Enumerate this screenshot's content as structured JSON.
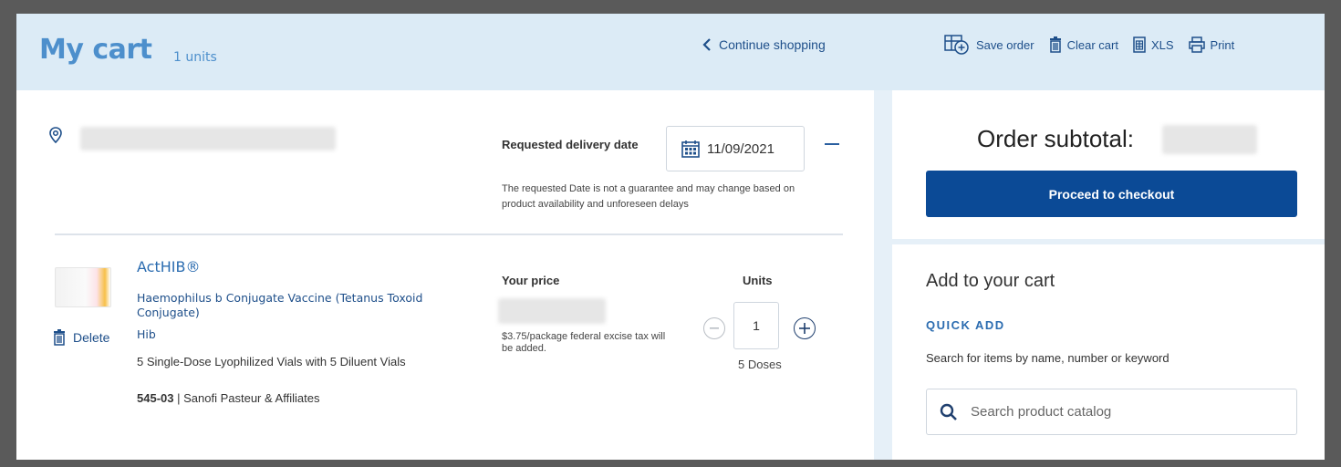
{
  "header": {
    "title": "My cart",
    "units_count": "1 units",
    "continue_label": "Continue shopping",
    "toolbar": {
      "save_order": "Save order",
      "clear_cart": "Clear cart",
      "xls": "XLS",
      "print": "Print"
    }
  },
  "delivery": {
    "requested_label": "Requested delivery date",
    "date": "11/09/2021",
    "note": "The requested Date is not a guarantee and may change based on product availability and unforeseen delays"
  },
  "item": {
    "name": "ActHIB®",
    "description": "Haemophilus b Conjugate Vaccine (Tetanus Toxoid Conjugate)",
    "abbreviation": "Hib",
    "packaging": "5 Single-Dose Lyophilized Vials with 5 Diluent Vials",
    "code": "545-03",
    "manufacturer": "| Sanofi Pasteur & Affiliates",
    "delete_label": "Delete",
    "price_label": "Your price",
    "price_note": "$3.75/package federal excise tax will be added.",
    "units_label": "Units",
    "quantity": "1",
    "doses": "5 Doses"
  },
  "summary": {
    "subtotal_label": "Order subtotal:",
    "checkout_label": "Proceed to checkout"
  },
  "add_to_cart": {
    "title": "Add to your cart",
    "quick_add": "QUICK ADD",
    "hint": "Search for items by name, number or keyword",
    "search_placeholder": "Search product catalog"
  },
  "colors": {
    "header_bg": "#dcebf6",
    "brand_blue": "#0b4a96",
    "title_blue": "#4d8fcc",
    "link_blue": "#1e4f8a"
  }
}
